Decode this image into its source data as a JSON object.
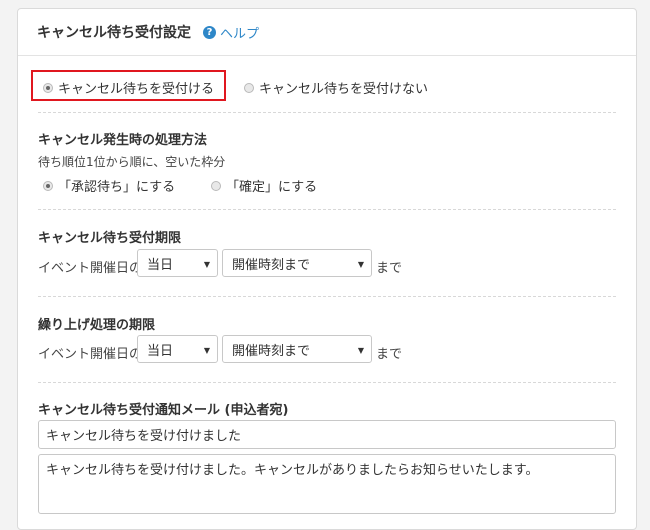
{
  "panel": {
    "title": "キャンセル待ち受付設定",
    "help_label": "ヘルプ",
    "help_glyph": "?"
  },
  "accept": {
    "options": [
      {
        "label": "キャンセル待ちを受付ける",
        "selected": true
      },
      {
        "label": "キャンセル待ちを受付けない",
        "selected": false
      }
    ]
  },
  "processing": {
    "title": "キャンセル発生時の処理方法",
    "note": "待ち順位1位から順に、空いた枠分",
    "options": [
      {
        "label": "「承認待ち」にする",
        "selected": true
      },
      {
        "label": "「確定」にする",
        "selected": false
      }
    ]
  },
  "deadline": {
    "title": "キャンセル待ち受付期限",
    "prefix": "イベント開催日の",
    "day_select": "当日",
    "time_select": "開催時刻まで",
    "suffix": "まで"
  },
  "promotion": {
    "title": "繰り上げ処理の期限",
    "prefix": "イベント開催日の",
    "day_select": "当日",
    "time_select": "開催時刻まで",
    "suffix": "まで"
  },
  "mail": {
    "title": "キャンセル待ち受付通知メール (申込者宛)",
    "subject": "キャンセル待ちを受け付けました",
    "body": "キャンセル待ちを受け付けました。キャンセルがありましたらお知らせいたします。"
  },
  "colors": {
    "highlight_border": "#e0171f",
    "link": "#2e87c8"
  }
}
